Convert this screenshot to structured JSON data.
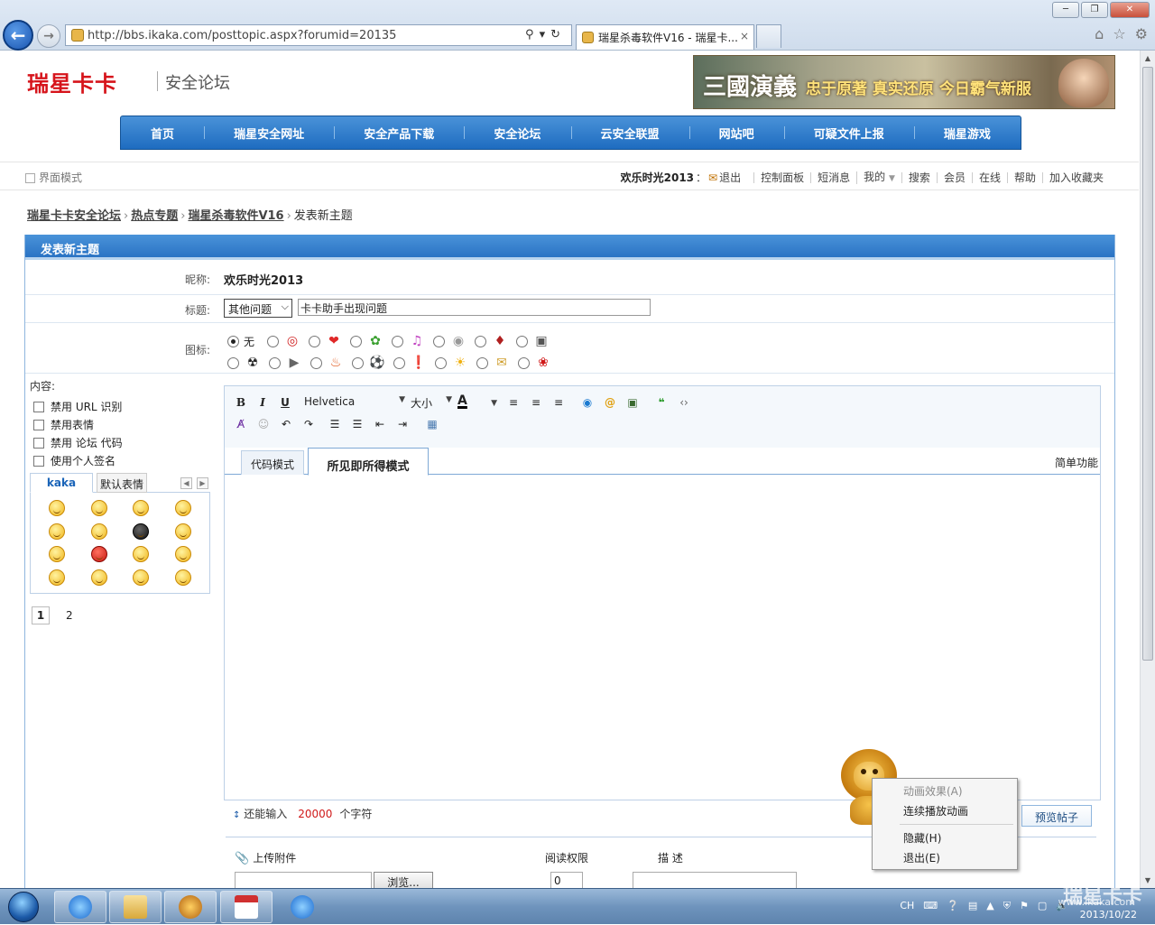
{
  "browser": {
    "url": "http://bbs.ikaka.com/posttopic.aspx?forumid=20135",
    "tab_title": "瑞星杀毒软件V16 - 瑞星卡...",
    "tab_close": "×"
  },
  "site": {
    "logo": "瑞星卡卡",
    "forum_name": "安全论坛",
    "banner_title": "三國演義",
    "banner_slogan": "忠于原著 真实还原 今日霸气新服"
  },
  "nav": [
    "首页",
    "瑞星安全网址",
    "安全产品下载",
    "安全论坛",
    "云安全联盟",
    "网站吧",
    "可疑文件上报",
    "瑞星游戏"
  ],
  "userbar": {
    "ui_mode": "界面模式",
    "username": "欢乐时光2013",
    "colon": "：",
    "logout": "退出",
    "links": [
      "控制面板",
      "短消息",
      "我的",
      "搜索",
      "会员",
      "在线",
      "帮助",
      "加入收藏夹"
    ]
  },
  "breadcrumb": {
    "items": [
      "瑞星卡卡安全论坛",
      "热点专题",
      "瑞星杀毒软件V16"
    ],
    "current": "发表新主题",
    "sep": "›"
  },
  "post": {
    "header": "发表新主题",
    "nick_label": "昵称:",
    "nick_value": "欢乐时光2013",
    "title_label": "标题:",
    "category": "其他问题",
    "title_value": "卡卡助手出现问题",
    "icon_label": "图标:",
    "icon_none": "无",
    "content_label": "内容:",
    "options": [
      "禁用 URL 识别",
      "禁用表情",
      "禁用 论坛 代码",
      "使用个人签名"
    ],
    "smiley_tabs": [
      "kaka",
      "默认表情"
    ],
    "pages": [
      "1",
      "2"
    ]
  },
  "editor": {
    "font": "Helvetica",
    "size": "大小",
    "tab_code": "代码模式",
    "tab_wysiwyg": "所见即所得模式",
    "simple": "简单功能"
  },
  "footer": {
    "can_input": "还能输入",
    "remaining": "20000",
    "chars": "个字符",
    "preview": "预览帖子",
    "upload": "上传附件",
    "read_perm": "阅读权限",
    "desc": "描  述",
    "browse": "浏览...",
    "perm_value": "0"
  },
  "context_menu": {
    "items": [
      "动画效果(A)",
      "连续播放动画",
      "隐藏(H)",
      "退出(E)"
    ]
  },
  "taskbar": {
    "tray": [
      "CH"
    ],
    "clock": "2013/10/22",
    "watermark": "瑞星卡卡",
    "watermark_url": "www.ikaka.com"
  },
  "colors": {
    "brand_red": "#d6141b",
    "nav_blue": "#1e6cc0",
    "counter_red": "#d01a1a"
  }
}
